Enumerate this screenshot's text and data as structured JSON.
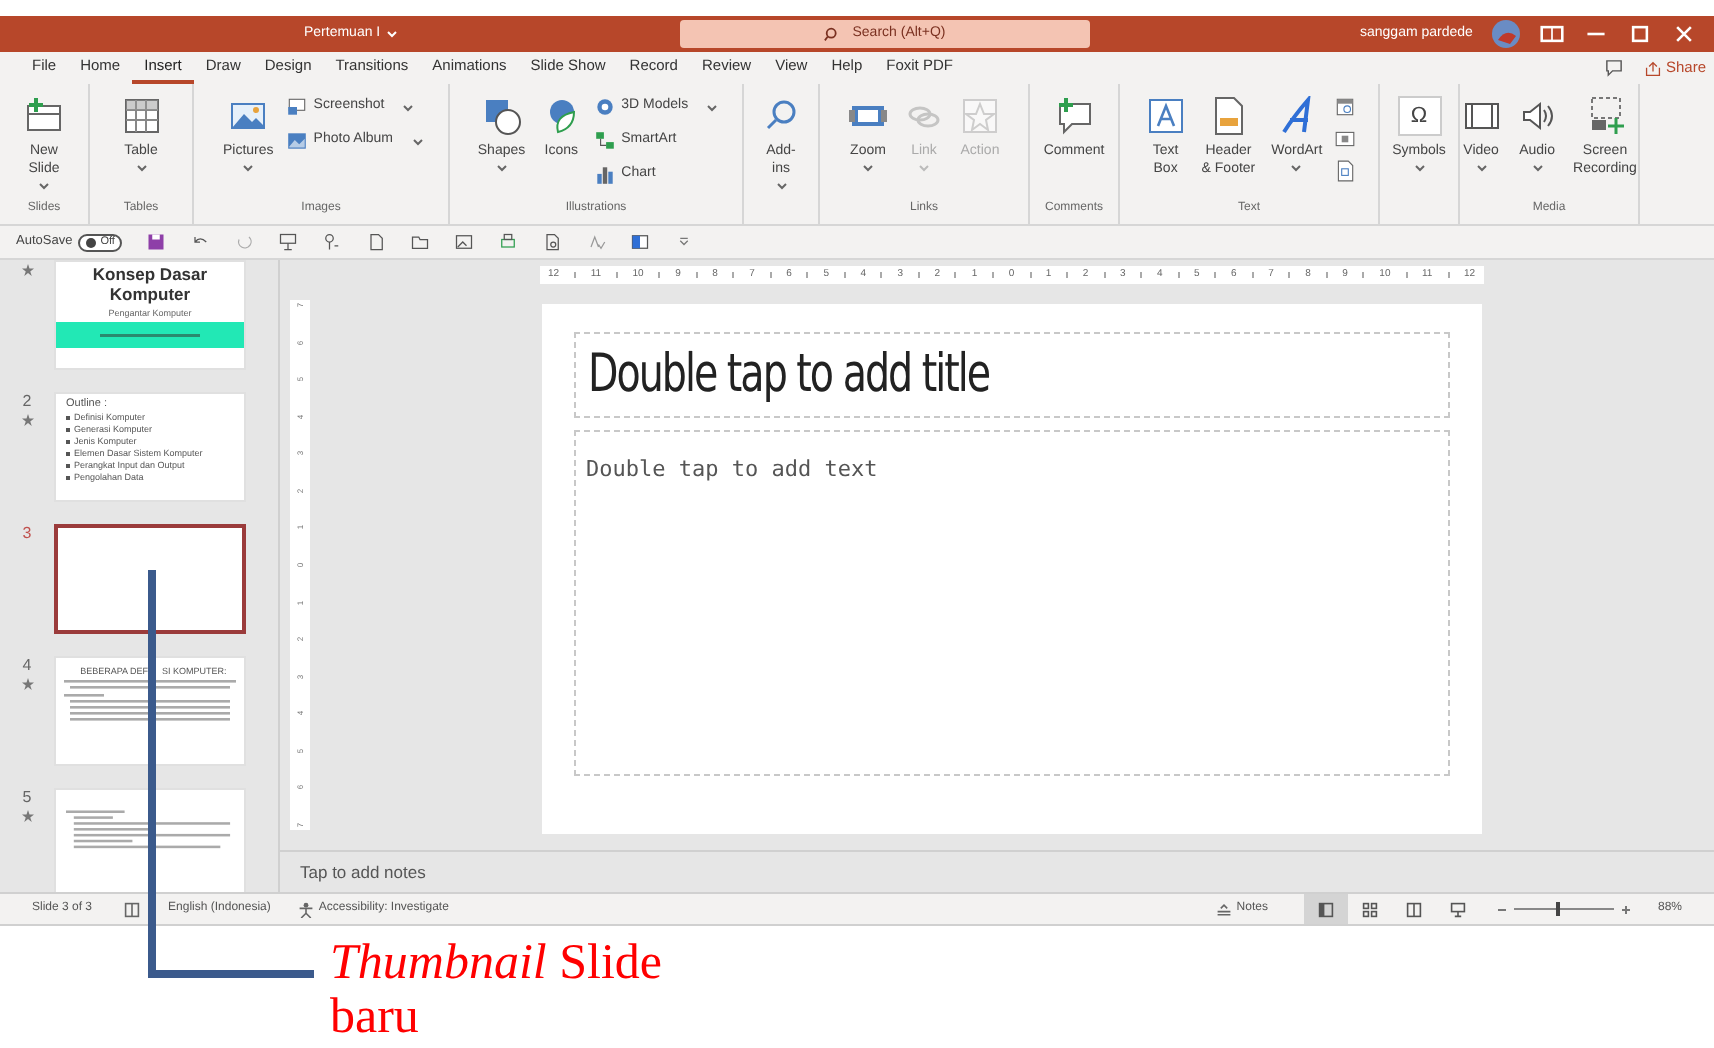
{
  "title_bar": {
    "document": "Pertemuan I",
    "search_placeholder": "Search (Alt+Q)",
    "user": "sanggam pardede"
  },
  "tabs": [
    {
      "label": "File",
      "selected": false
    },
    {
      "label": "Home",
      "selected": false
    },
    {
      "label": "Insert",
      "selected": true
    },
    {
      "label": "Draw",
      "selected": false
    },
    {
      "label": "Design",
      "selected": false
    },
    {
      "label": "Transitions",
      "selected": false
    },
    {
      "label": "Animations",
      "selected": false
    },
    {
      "label": "Slide Show",
      "selected": false
    },
    {
      "label": "Record",
      "selected": false
    },
    {
      "label": "Review",
      "selected": false
    },
    {
      "label": "View",
      "selected": false
    },
    {
      "label": "Help",
      "selected": false
    },
    {
      "label": "Foxit PDF",
      "selected": false
    }
  ],
  "share_button": "Share",
  "ribbon": {
    "groups": [
      {
        "label": "Slides",
        "items": [
          {
            "kind": "large",
            "label": "New\nSlide",
            "dropdown": true,
            "disabled": false
          }
        ]
      },
      {
        "label": "Tables",
        "items": [
          {
            "kind": "large",
            "label": "Table",
            "dropdown": true,
            "disabled": false
          }
        ]
      },
      {
        "label": "Images",
        "items": [
          {
            "kind": "large",
            "label": "Pictures",
            "dropdown": true,
            "disabled": false
          },
          {
            "kind": "stack",
            "items": [
              {
                "label": "Screenshot",
                "dropdown": true,
                "disabled": false
              },
              {
                "label": "Photo Album",
                "dropdown": true,
                "disabled": false
              }
            ]
          }
        ]
      },
      {
        "label": "Illustrations",
        "items": [
          {
            "kind": "large",
            "label": "Shapes",
            "dropdown": true,
            "disabled": false
          },
          {
            "kind": "large",
            "label": "Icons",
            "dropdown": false,
            "disabled": false
          },
          {
            "kind": "stack",
            "items": [
              {
                "label": "3D Models",
                "dropdown": true,
                "disabled": false
              },
              {
                "label": "SmartArt",
                "dropdown": false,
                "disabled": false
              },
              {
                "label": "Chart",
                "dropdown": false,
                "disabled": false
              }
            ]
          }
        ]
      },
      {
        "items": [
          {
            "kind": "large",
            "label": "Add-\nins",
            "dropdown": true,
            "disabled": false
          }
        ]
      },
      {
        "label": "Links",
        "items": [
          {
            "kind": "large",
            "label": "Zoom",
            "dropdown": true,
            "disabled": false
          },
          {
            "kind": "large",
            "label": "Link",
            "dropdown": true,
            "disabled": true
          },
          {
            "kind": "large",
            "label": "Action",
            "dropdown": false,
            "disabled": true
          }
        ]
      },
      {
        "label": "Comments",
        "items": [
          {
            "kind": "large",
            "label": "Comment",
            "dropdown": false,
            "disabled": false
          }
        ]
      },
      {
        "label": "Text",
        "items": [
          {
            "kind": "large",
            "label": "Text\nBox",
            "dropdown": false,
            "disabled": false
          },
          {
            "kind": "large",
            "label": "Header\n& Footer",
            "dropdown": false,
            "disabled": false
          },
          {
            "kind": "large",
            "label": "WordArt",
            "dropdown": true,
            "disabled": false
          },
          {
            "kind": "icons"
          }
        ]
      },
      {
        "items": [
          {
            "kind": "large",
            "label": "Symbols",
            "glyph": "Ω",
            "dropdown": true,
            "disabled": false
          }
        ]
      },
      {
        "label": "Media",
        "items": [
          {
            "kind": "large",
            "label": "Video",
            "dropdown": true,
            "disabled": false
          },
          {
            "kind": "large",
            "label": "Audio",
            "dropdown": true,
            "disabled": false
          },
          {
            "kind": "large",
            "label": "Screen\nRecording",
            "dropdown": false,
            "disabled": false
          }
        ]
      }
    ]
  },
  "quick_access": {
    "autosave_label": "AutoSave",
    "autosave": {
      "on": false,
      "label": "Off"
    }
  },
  "thumbnails": [
    {
      "kind": "title",
      "transition": true,
      "selected": false,
      "title": "Konsep Dasar\nKomputer",
      "subtitle": "Pengantar Komputer"
    },
    {
      "kind": "bullets",
      "number": "2",
      "transition": true,
      "selected": false,
      "heading": "Outline :",
      "bullets": [
        "Definisi Komputer",
        "Generasi Komputer",
        "Jenis Komputer",
        "Elemen Dasar Sistem Komputer",
        "Perangkat Input dan Output",
        "Pengolahan Data"
      ]
    },
    {
      "kind": "blank",
      "number": "3",
      "transition": false,
      "selected": true
    },
    {
      "kind": "text",
      "number": "4",
      "transition": true,
      "selected": false,
      "heading": [
        "BEBERAPA DEF",
        "SI KOMPUTER:"
      ]
    },
    {
      "kind": "lines",
      "number": "5",
      "transition": true,
      "selected": false
    }
  ],
  "ruler": {
    "horizontal": [
      "12",
      "11",
      "10",
      "9",
      "8",
      "7",
      "6",
      "5",
      "4",
      "3",
      "2",
      "1",
      "0",
      "1",
      "2",
      "3",
      "4",
      "5",
      "6",
      "7",
      "8",
      "9",
      "10",
      "11",
      "12"
    ],
    "vertical": [
      "7",
      "6",
      "5",
      "4",
      "3",
      "2",
      "1",
      "0",
      "1",
      "2",
      "3",
      "4",
      "5",
      "6",
      "7"
    ]
  },
  "slide": {
    "title_placeholder": "Double tap to add title",
    "body_placeholder": "Double tap to add text"
  },
  "notes_placeholder": "Tap to add notes",
  "status_bar": {
    "slide": "Slide 3 of 3",
    "language": "English (Indonesia)",
    "accessibility": "Accessibility: Investigate",
    "notes": "Notes",
    "views": [
      {
        "selected": true
      },
      {
        "selected": false
      },
      {
        "selected": false
      },
      {
        "selected": false
      }
    ],
    "zoom_slider": {
      "level": 0.42
    },
    "zoom": "88%"
  },
  "annotation": {
    "text": "*Thumbnail* Slide baru"
  }
}
